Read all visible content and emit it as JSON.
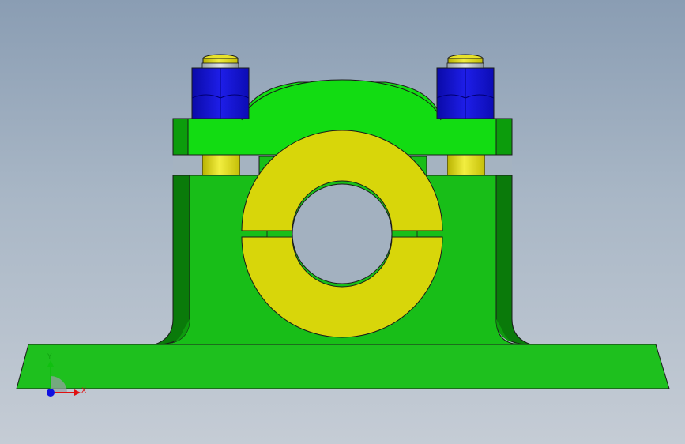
{
  "view": {
    "background_top": "#8a9db3",
    "background_bottom": "#c5ccd5"
  },
  "parts": {
    "housing_color": "#18c418",
    "cap_color": "#12dc12",
    "bearing_shell_color": "#d8d60a",
    "nut_color": "#1414dc",
    "stud_color": "#e2dc1a",
    "edge_color": "#1a1a1a"
  },
  "triad": {
    "x_label": "X",
    "y_label": "Y",
    "x_color": "#e01010",
    "y_color": "#10c010",
    "z_color": "#1010e0"
  }
}
